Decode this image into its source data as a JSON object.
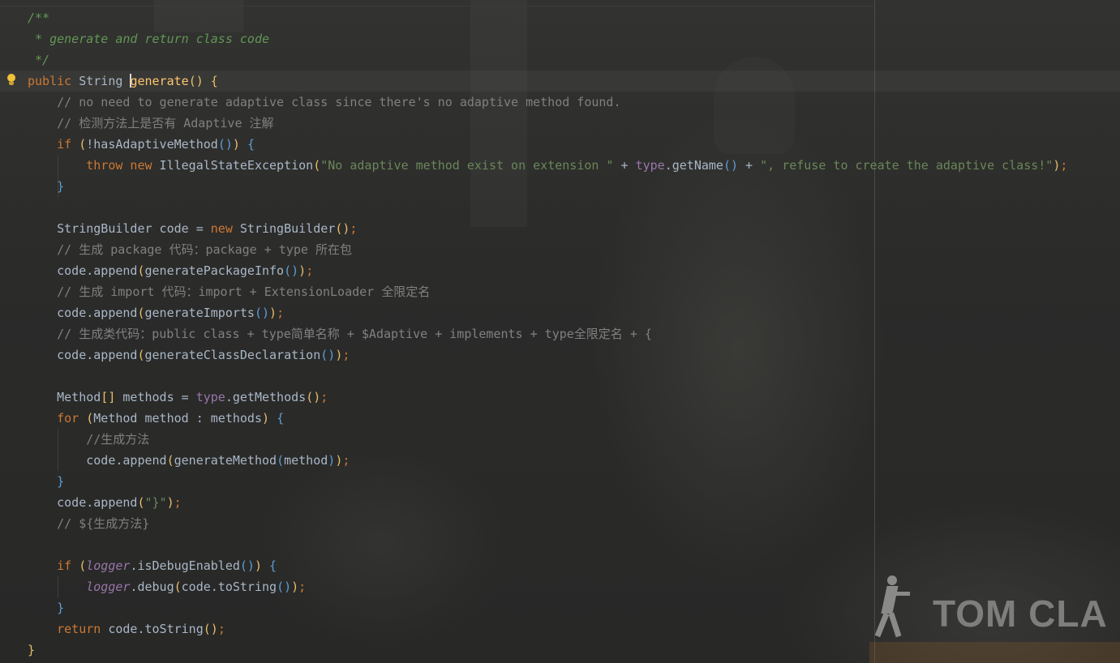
{
  "editor": {
    "lines": [
      [
        {
          "t": "/**",
          "c": "d"
        }
      ],
      [
        {
          "t": " * generate and return class code",
          "c": "d"
        }
      ],
      [
        {
          "t": " */",
          "c": "d"
        }
      ],
      [
        {
          "t": "public",
          "c": "k"
        },
        {
          "t": " String ",
          "c": ""
        },
        {
          "t": "CARET",
          "c": "caret"
        },
        {
          "t": "generate",
          "c": "dl"
        },
        {
          "t": "()",
          "c": "p1"
        },
        {
          "t": " ",
          "c": ""
        },
        {
          "t": "{",
          "c": "p1"
        }
      ],
      [
        {
          "t": "    ",
          "c": ""
        },
        {
          "t": "// no need to generate adaptive class since there's no adaptive method found.",
          "c": "c"
        }
      ],
      [
        {
          "t": "    ",
          "c": ""
        },
        {
          "t": "// 检测方法上是否有 Adaptive 注解",
          "c": "c"
        }
      ],
      [
        {
          "t": "    ",
          "c": ""
        },
        {
          "t": "if",
          "c": "k"
        },
        {
          "t": " ",
          "c": ""
        },
        {
          "t": "(",
          "c": "p1"
        },
        {
          "t": "!hasAdaptiveMethod",
          "c": ""
        },
        {
          "t": "()",
          "c": "p2"
        },
        {
          "t": ")",
          "c": "p1"
        },
        {
          "t": " ",
          "c": ""
        },
        {
          "t": "{",
          "c": "p2"
        }
      ],
      [
        {
          "t": "        ",
          "c": ""
        },
        {
          "t": "throw new",
          "c": "k"
        },
        {
          "t": " IllegalStateException",
          "c": ""
        },
        {
          "t": "(",
          "c": "p1"
        },
        {
          "t": "\"No adaptive method exist on extension \"",
          "c": "s"
        },
        {
          "t": " + ",
          "c": ""
        },
        {
          "t": "type",
          "c": "f"
        },
        {
          "t": ".getName",
          "c": ""
        },
        {
          "t": "()",
          "c": "p2"
        },
        {
          "t": " + ",
          "c": ""
        },
        {
          "t": "\", refuse to create the adaptive class!\"",
          "c": "s"
        },
        {
          "t": ")",
          "c": "p1"
        },
        {
          "t": ";",
          "c": "k"
        }
      ],
      [
        {
          "t": "    ",
          "c": ""
        },
        {
          "t": "}",
          "c": "p2"
        }
      ],
      [],
      [
        {
          "t": "    StringBuilder code = ",
          "c": ""
        },
        {
          "t": "new",
          "c": "k"
        },
        {
          "t": " StringBuilder",
          "c": ""
        },
        {
          "t": "()",
          "c": "p1"
        },
        {
          "t": ";",
          "c": "k"
        }
      ],
      [
        {
          "t": "    ",
          "c": ""
        },
        {
          "t": "// 生成 package 代码：package + type 所在包",
          "c": "c"
        }
      ],
      [
        {
          "t": "    code.append",
          "c": ""
        },
        {
          "t": "(",
          "c": "p1"
        },
        {
          "t": "generatePackageInfo",
          "c": ""
        },
        {
          "t": "()",
          "c": "p2"
        },
        {
          "t": ")",
          "c": "p1"
        },
        {
          "t": ";",
          "c": "k"
        }
      ],
      [
        {
          "t": "    ",
          "c": ""
        },
        {
          "t": "// 生成 import 代码：import + ExtensionLoader 全限定名",
          "c": "c"
        }
      ],
      [
        {
          "t": "    code.append",
          "c": ""
        },
        {
          "t": "(",
          "c": "p1"
        },
        {
          "t": "generateImports",
          "c": ""
        },
        {
          "t": "()",
          "c": "p2"
        },
        {
          "t": ")",
          "c": "p1"
        },
        {
          "t": ";",
          "c": "k"
        }
      ],
      [
        {
          "t": "    ",
          "c": ""
        },
        {
          "t": "// 生成类代码：public class + type简单名称 + $Adaptive + implements + type全限定名 + {",
          "c": "c"
        }
      ],
      [
        {
          "t": "    code.append",
          "c": ""
        },
        {
          "t": "(",
          "c": "p1"
        },
        {
          "t": "generateClassDeclaration",
          "c": ""
        },
        {
          "t": "()",
          "c": "p2"
        },
        {
          "t": ")",
          "c": "p1"
        },
        {
          "t": ";",
          "c": "k"
        }
      ],
      [],
      [
        {
          "t": "    Method",
          "c": ""
        },
        {
          "t": "[]",
          "c": "p1"
        },
        {
          "t": " methods = ",
          "c": ""
        },
        {
          "t": "type",
          "c": "f"
        },
        {
          "t": ".getMethods",
          "c": ""
        },
        {
          "t": "()",
          "c": "p1"
        },
        {
          "t": ";",
          "c": "k"
        }
      ],
      [
        {
          "t": "    ",
          "c": ""
        },
        {
          "t": "for",
          "c": "k"
        },
        {
          "t": " ",
          "c": ""
        },
        {
          "t": "(",
          "c": "p1"
        },
        {
          "t": "Method method : methods",
          "c": ""
        },
        {
          "t": ")",
          "c": "p1"
        },
        {
          "t": " ",
          "c": ""
        },
        {
          "t": "{",
          "c": "p2"
        }
      ],
      [
        {
          "t": "        ",
          "c": ""
        },
        {
          "t": "//生成方法",
          "c": "c"
        }
      ],
      [
        {
          "t": "        code.append",
          "c": ""
        },
        {
          "t": "(",
          "c": "p1"
        },
        {
          "t": "generateMethod",
          "c": ""
        },
        {
          "t": "(",
          "c": "p2"
        },
        {
          "t": "method",
          "c": ""
        },
        {
          "t": ")",
          "c": "p2"
        },
        {
          "t": ")",
          "c": "p1"
        },
        {
          "t": ";",
          "c": "k"
        }
      ],
      [
        {
          "t": "    ",
          "c": ""
        },
        {
          "t": "}",
          "c": "p2"
        }
      ],
      [
        {
          "t": "    code.append",
          "c": ""
        },
        {
          "t": "(",
          "c": "p1"
        },
        {
          "t": "\"}\"",
          "c": "s"
        },
        {
          "t": ")",
          "c": "p1"
        },
        {
          "t": ";",
          "c": "k"
        }
      ],
      [
        {
          "t": "    ",
          "c": ""
        },
        {
          "t": "// ${生成方法}",
          "c": "c"
        }
      ],
      [],
      [
        {
          "t": "    ",
          "c": ""
        },
        {
          "t": "if",
          "c": "k"
        },
        {
          "t": " ",
          "c": ""
        },
        {
          "t": "(",
          "c": "p1"
        },
        {
          "t": "logger",
          "c": "fi"
        },
        {
          "t": ".isDebugEnabled",
          "c": ""
        },
        {
          "t": "()",
          "c": "p2"
        },
        {
          "t": ")",
          "c": "p1"
        },
        {
          "t": " ",
          "c": ""
        },
        {
          "t": "{",
          "c": "p2"
        }
      ],
      [
        {
          "t": "        ",
          "c": ""
        },
        {
          "t": "logger",
          "c": "fi"
        },
        {
          "t": ".debug",
          "c": ""
        },
        {
          "t": "(",
          "c": "p1"
        },
        {
          "t": "code.toString",
          "c": ""
        },
        {
          "t": "()",
          "c": "p2"
        },
        {
          "t": ")",
          "c": "p1"
        },
        {
          "t": ";",
          "c": "k"
        }
      ],
      [
        {
          "t": "    ",
          "c": ""
        },
        {
          "t": "}",
          "c": "p2"
        }
      ],
      [
        {
          "t": "    ",
          "c": ""
        },
        {
          "t": "return",
          "c": "k"
        },
        {
          "t": " code.toString",
          "c": ""
        },
        {
          "t": "()",
          "c": "p1"
        },
        {
          "t": ";",
          "c": "k"
        }
      ],
      [
        {
          "t": "}",
          "c": "p1"
        }
      ]
    ]
  },
  "gutter": {
    "intention_icon": "lightbulb-icon",
    "icon_color": "#f0c23b"
  },
  "background_art": {
    "logo_text": "TOM CLA"
  },
  "colors": {
    "background": "#2b2b2b",
    "text": "#a9b7c6",
    "keyword": "#cc7832",
    "string": "#6a8759",
    "comment": "#808080",
    "doc_comment": "#629755",
    "field": "#9876aa",
    "method_declaration": "#ffc66d"
  }
}
